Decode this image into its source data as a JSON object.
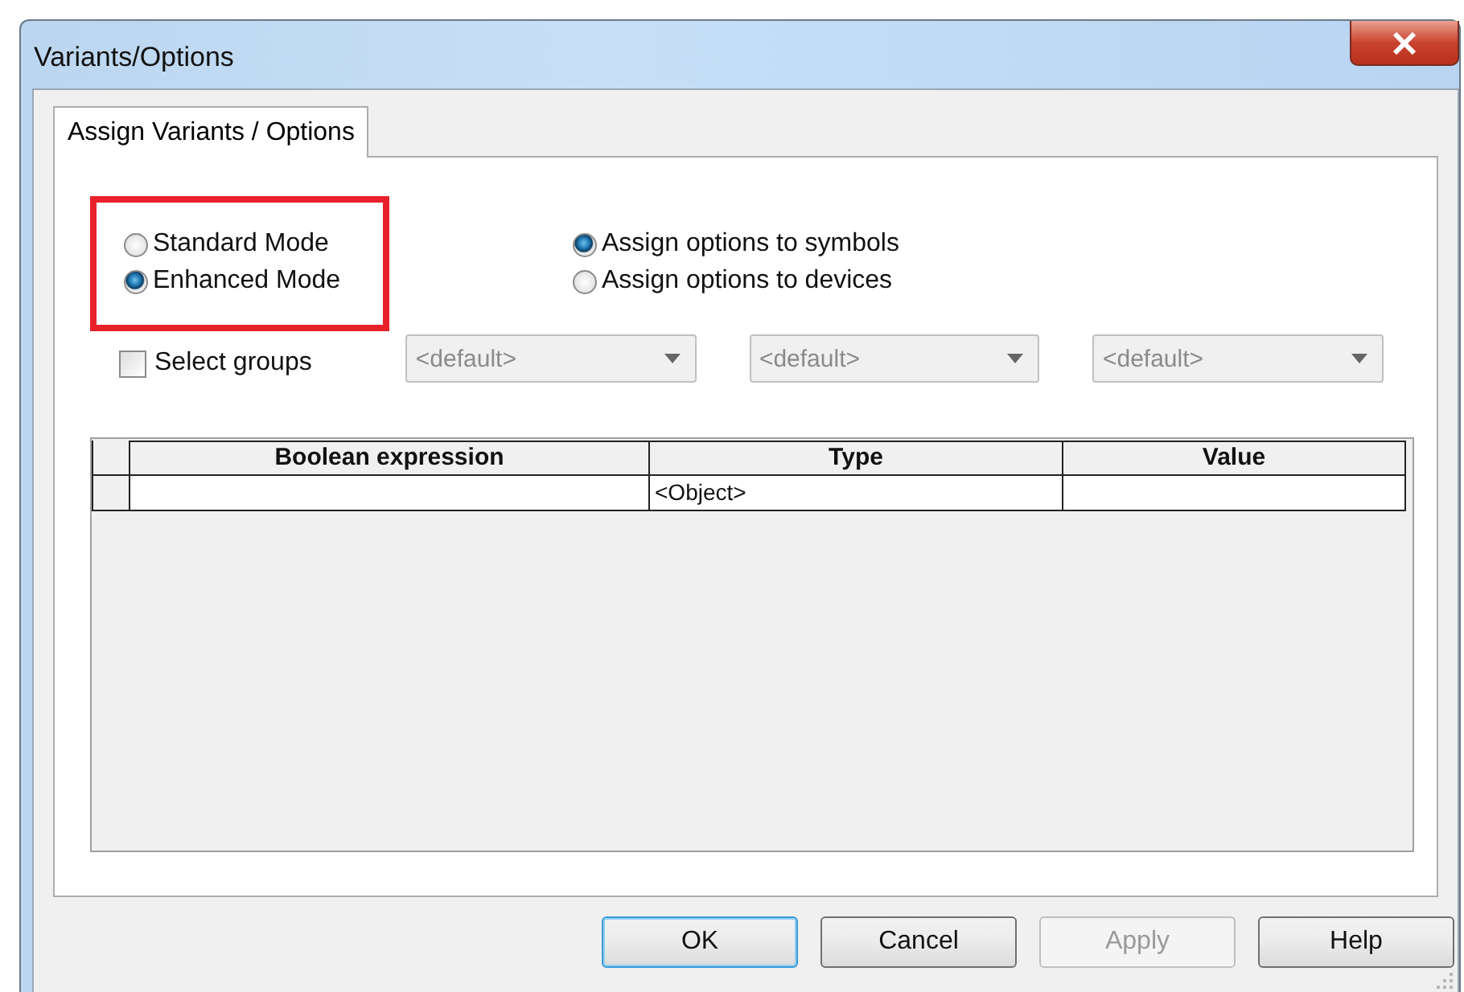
{
  "window": {
    "title": "Variants/Options"
  },
  "tabs": [
    {
      "label": "Assign Variants / Options",
      "selected": true
    }
  ],
  "mode_group": {
    "highlighted": true,
    "options": [
      {
        "label": "Standard Mode",
        "selected": false
      },
      {
        "label": "Enhanced Mode",
        "selected": true
      }
    ]
  },
  "assign_group": {
    "options": [
      {
        "label": "Assign options to symbols",
        "selected": true
      },
      {
        "label": "Assign options to devices",
        "selected": false
      }
    ]
  },
  "select_groups": {
    "label": "Select groups",
    "checked": false
  },
  "dropdowns": [
    {
      "value": "<default>",
      "disabled": true
    },
    {
      "value": "<default>",
      "disabled": true
    },
    {
      "value": "<default>",
      "disabled": true
    }
  ],
  "table": {
    "columns": [
      "Boolean expression",
      "Type",
      "Value"
    ],
    "rows": [
      [
        "",
        "<Object>",
        ""
      ]
    ]
  },
  "buttons": [
    {
      "label": "OK",
      "default": true,
      "disabled": false
    },
    {
      "label": "Cancel",
      "default": false,
      "disabled": false
    },
    {
      "label": "Apply",
      "default": false,
      "disabled": true
    },
    {
      "label": "Help",
      "default": false,
      "disabled": false
    }
  ]
}
